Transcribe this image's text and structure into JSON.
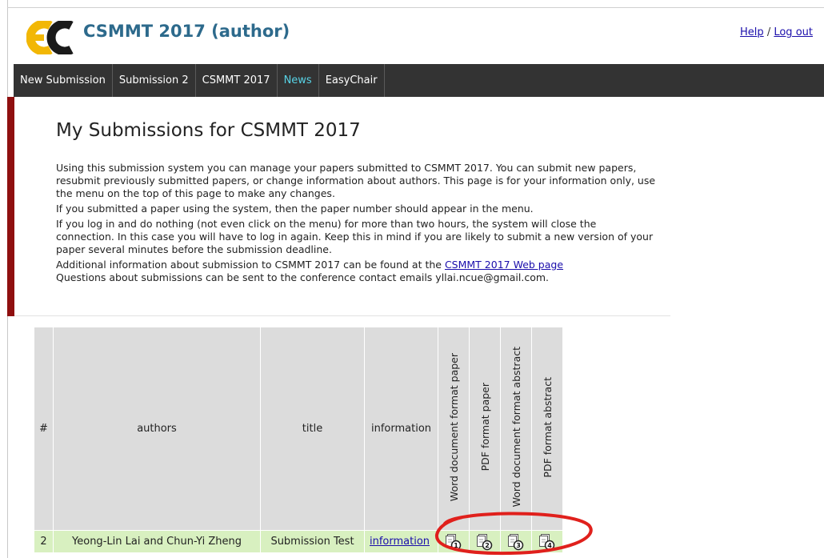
{
  "header": {
    "app_title": "CSMMT 2017 (author)",
    "links": {
      "help": "Help",
      "separator": "/",
      "logout": "Log out"
    }
  },
  "nav": {
    "items": [
      {
        "label": "New Submission",
        "active": false
      },
      {
        "label": "Submission 2",
        "active": false
      },
      {
        "label": "CSMMT 2017",
        "active": false
      },
      {
        "label": "News",
        "active": true
      },
      {
        "label": "EasyChair",
        "active": false
      }
    ]
  },
  "main": {
    "title": "My Submissions for CSMMT 2017",
    "paragraphs": [
      "Using this submission system you can manage your papers submitted to CSMMT 2017. You can submit new papers, resubmit previously submitted papers, or change information about authors. This page is for your information only, use the menu on the top of this page to make any changes.",
      "If you submitted a paper using the system, then the paper number should appear in the menu.",
      "If you log in and do nothing (not even click on the menu) for more than two hours, the system will close the connection. In this case you will have to log in again. Keep this in mind if you are likely to submit a new version of your paper several minutes before the submission deadline."
    ],
    "additional_info_prefix": "Additional information about submission to CSMMT 2017 can be found at the",
    "web_page_link": "CSMMT 2017 Web page",
    "contact_text": "Questions about submissions can be sent to the conference contact emails yllai.ncue@gmail.com."
  },
  "table": {
    "headers": {
      "num": "#",
      "authors": "authors",
      "title": "title",
      "information": "information",
      "word_paper": "Word document format paper",
      "pdf_paper": "PDF format paper",
      "word_abstract": "Word document format abstract",
      "pdf_abstract": "PDF format abstract"
    },
    "rows": [
      {
        "num": "2",
        "authors": "Yeong-Lin Lai and Chun-Yi Zheng",
        "title": "Submission Test",
        "information": "information",
        "files": [
          "1",
          "2",
          "3",
          "4"
        ]
      }
    ]
  },
  "icons": {
    "file": "document-icon",
    "logo": "easychair-logo"
  },
  "colors": {
    "nav_bg": "#333333",
    "nav_active": "#58d3e6",
    "accent_bar": "#8f0f0f",
    "title_blue": "#2d6a8c",
    "row_bg": "#d8f0c0",
    "header_bg": "#dcdcdc",
    "annotation": "#e0201c"
  }
}
